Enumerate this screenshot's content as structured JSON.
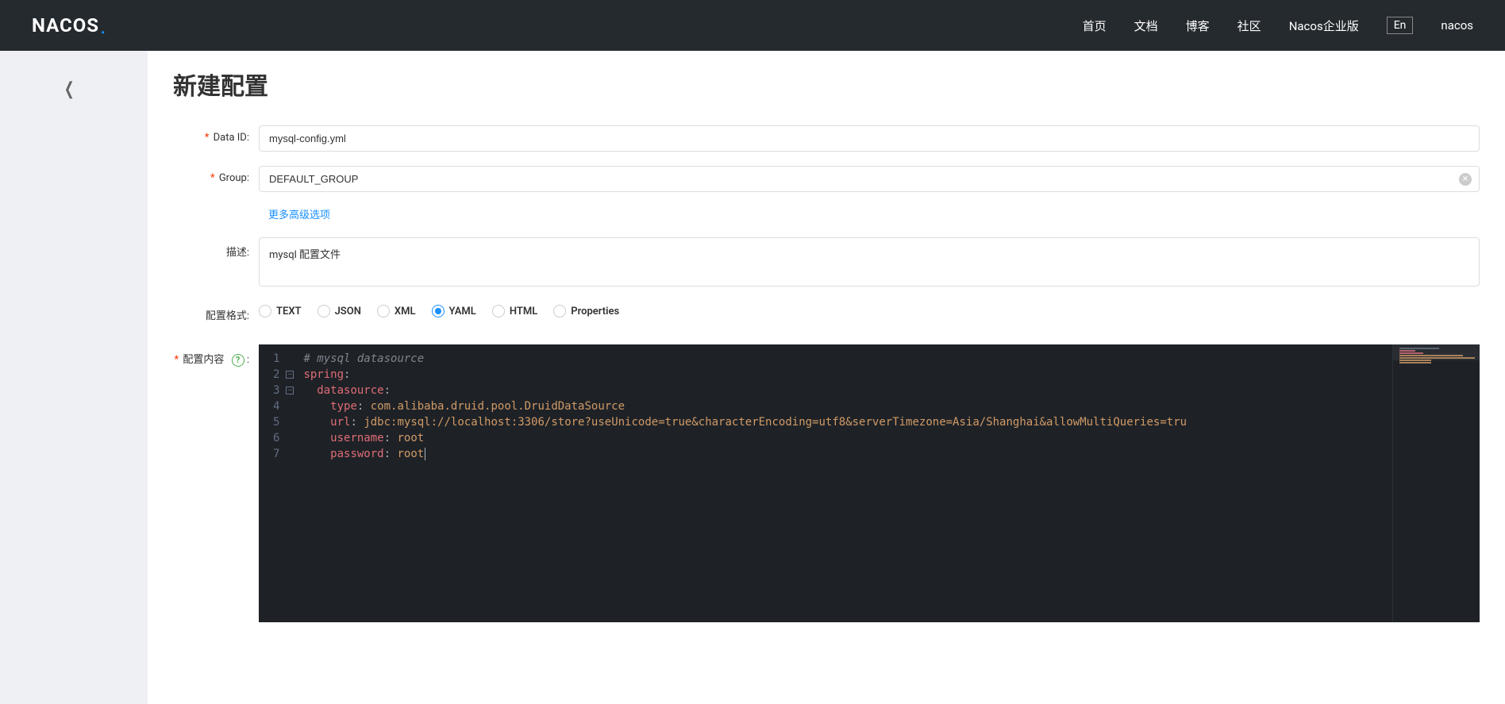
{
  "header": {
    "logo": "NACOS",
    "nav": {
      "home": "首页",
      "docs": "文档",
      "blog": "博客",
      "community": "社区",
      "enterprise": "Nacos企业版",
      "lang": "En",
      "user": "nacos"
    }
  },
  "page": {
    "title": "新建配置"
  },
  "form": {
    "dataId": {
      "label": "Data ID:",
      "value": "mysql-config.yml"
    },
    "group": {
      "label": "Group:",
      "value": "DEFAULT_GROUP"
    },
    "advancedLink": "更多高级选项",
    "description": {
      "label": "描述:",
      "value": "mysql 配置文件"
    },
    "format": {
      "label": "配置格式:",
      "options": {
        "text": "TEXT",
        "json": "JSON",
        "xml": "XML",
        "yaml": "YAML",
        "html": "HTML",
        "properties": "Properties"
      },
      "selected": "yaml"
    },
    "content": {
      "label": "配置内容",
      "colon": ":",
      "lines": {
        "l1_comment": "# mysql datasource",
        "l2_key": "spring",
        "l3_key": "datasource",
        "l4_key": "type",
        "l4_val": "com.alibaba.druid.pool.DruidDataSource",
        "l5_key": "url",
        "l5_val": "jdbc:mysql://localhost:3306/store?useUnicode=true&characterEncoding=utf8&serverTimezone=Asia/Shanghai&allowMultiQueries=tru",
        "l6_key": "username",
        "l6_val": "root",
        "l7_key": "password",
        "l7_val": "root"
      },
      "lineNumbers": [
        "1",
        "2",
        "3",
        "4",
        "5",
        "6",
        "7"
      ]
    }
  }
}
